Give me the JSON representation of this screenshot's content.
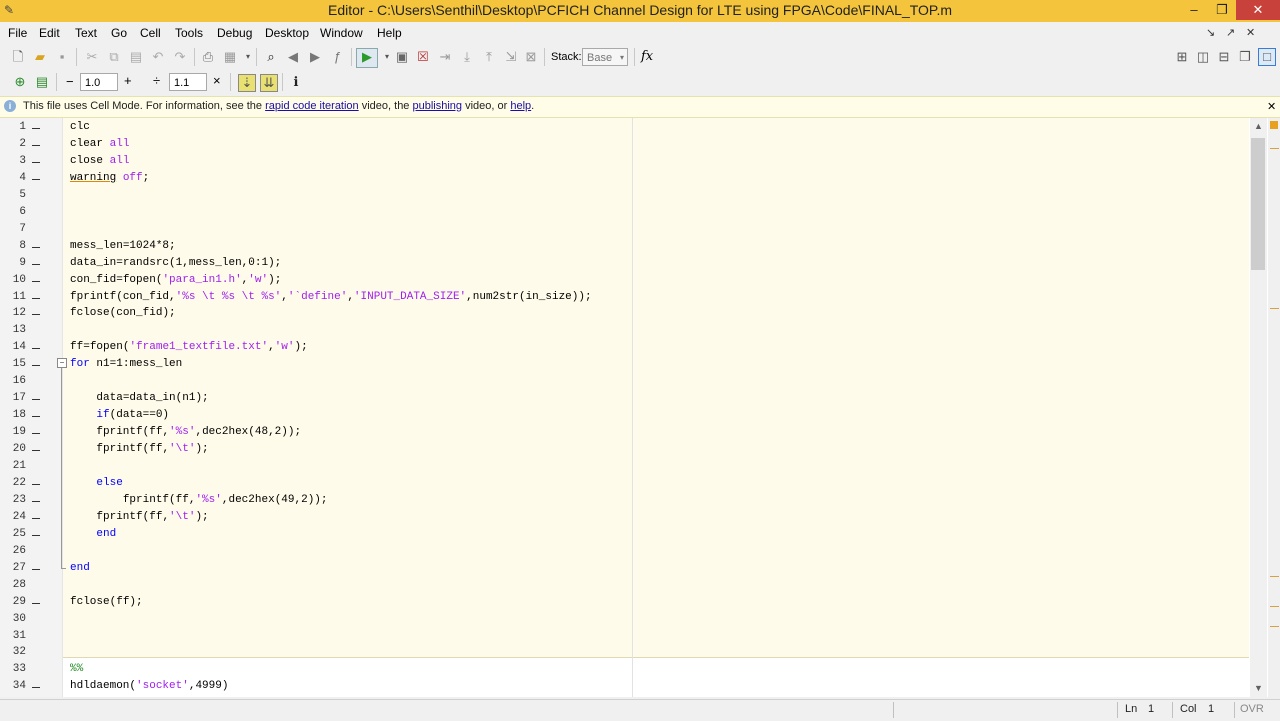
{
  "window": {
    "title": "Editor - C:\\Users\\Senthil\\Desktop\\PCFICH Channel Design for LTE using FPGA\\Code\\FINAL_TOP.m",
    "minimize_glyph": "–",
    "maximize_glyph": "❐",
    "close_glyph": "✕"
  },
  "menu": [
    "File",
    "Edit",
    "Text",
    "Go",
    "Cell",
    "Tools",
    "Debug",
    "Desktop",
    "Window",
    "Help"
  ],
  "menu_right": {
    "dock_glyph": "↘",
    "undock_glyph": "↗",
    "close_glyph": "✕"
  },
  "toolbar": {
    "stack_label": "Stack:",
    "stack_value": "Base",
    "fx_label": "fx"
  },
  "cell_toolbar": {
    "minus": "−",
    "value1": "1.0",
    "plus": "+",
    "divide": "÷",
    "value2": "1.1",
    "times": "×"
  },
  "info_bar": {
    "prefix": "This file uses Cell Mode. For information, see the ",
    "link1": "rapid code iteration",
    "mid1": " video, the ",
    "link2": "publishing",
    "mid2": " video, or ",
    "link3": "help",
    "suffix": "."
  },
  "code_lines": [
    {
      "n": "1",
      "dash": true,
      "text": "clc"
    },
    {
      "n": "2",
      "dash": true,
      "text": "clear all"
    },
    {
      "n": "3",
      "dash": true,
      "text": "close all"
    },
    {
      "n": "4",
      "dash": true,
      "text": "warning off;"
    },
    {
      "n": "5",
      "dash": false,
      "text": ""
    },
    {
      "n": "6",
      "dash": false,
      "text": ""
    },
    {
      "n": "7",
      "dash": false,
      "text": ""
    },
    {
      "n": "8",
      "dash": true,
      "text": "mess_len=1024*8;"
    },
    {
      "n": "9",
      "dash": true,
      "text": "data_in=randsrc(1,mess_len,0:1);"
    },
    {
      "n": "10",
      "dash": true,
      "text": "con_fid=fopen('para_in1.h','w');"
    },
    {
      "n": "11",
      "dash": true,
      "text": "fprintf(con_fid,'%s \\t %s \\t %s','`define','INPUT_DATA_SIZE',num2str(in_size));"
    },
    {
      "n": "12",
      "dash": true,
      "text": "fclose(con_fid);"
    },
    {
      "n": "13",
      "dash": false,
      "text": ""
    },
    {
      "n": "14",
      "dash": true,
      "text": "ff=fopen('frame1_textfile.txt','w');"
    },
    {
      "n": "15",
      "dash": true,
      "text": "for n1=1:mess_len"
    },
    {
      "n": "16",
      "dash": false,
      "text": ""
    },
    {
      "n": "17",
      "dash": true,
      "text": "    data=data_in(n1);"
    },
    {
      "n": "18",
      "dash": true,
      "text": "    if(data==0)"
    },
    {
      "n": "19",
      "dash": true,
      "text": "    fprintf(ff,'%s',dec2hex(48,2));"
    },
    {
      "n": "20",
      "dash": true,
      "text": "    fprintf(ff,'\\t');"
    },
    {
      "n": "21",
      "dash": false,
      "text": ""
    },
    {
      "n": "22",
      "dash": true,
      "text": "    else"
    },
    {
      "n": "23",
      "dash": true,
      "text": "        fprintf(ff,'%s',dec2hex(49,2));"
    },
    {
      "n": "24",
      "dash": true,
      "text": "    fprintf(ff,'\\t');"
    },
    {
      "n": "25",
      "dash": true,
      "text": "    end"
    },
    {
      "n": "26",
      "dash": false,
      "text": ""
    },
    {
      "n": "27",
      "dash": true,
      "text": "end"
    },
    {
      "n": "28",
      "dash": false,
      "text": ""
    },
    {
      "n": "29",
      "dash": true,
      "text": "fclose(ff);"
    },
    {
      "n": "30",
      "dash": false,
      "text": ""
    },
    {
      "n": "31",
      "dash": false,
      "text": ""
    },
    {
      "n": "32",
      "dash": false,
      "text": ""
    },
    {
      "n": "33",
      "dash": false,
      "text": "%%"
    },
    {
      "n": "34",
      "dash": true,
      "text": "hdldaemon('socket',4999)"
    }
  ],
  "fold_glyph": "−",
  "status": {
    "ln_label": "Ln",
    "ln_value": "1",
    "col_label": "Col",
    "col_value": "1",
    "mode": "OVR"
  },
  "colors": {
    "title_bar": "#f4c53c",
    "cell_highlight": "#fffbea",
    "keyword": "#0000ff",
    "string": "#a020f0",
    "comment": "#228b22"
  }
}
